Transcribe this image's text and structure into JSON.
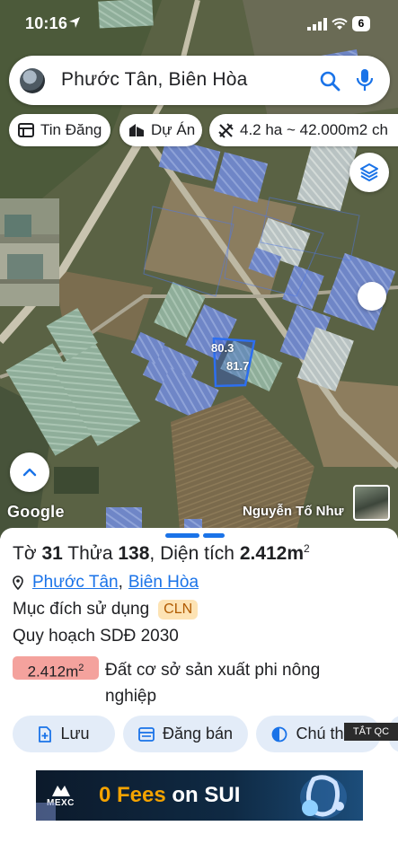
{
  "status_bar": {
    "time": "10:16",
    "battery": "6"
  },
  "search": {
    "query": "Phước Tân, Biên Hòa"
  },
  "chips": [
    {
      "label": "Tin Đăng",
      "icon": "listing-icon"
    },
    {
      "label": "Dự Án",
      "icon": "project-icon"
    },
    {
      "label": "4.2 ha ~ 42.000m2 ch",
      "icon": "measure-icon"
    }
  ],
  "map": {
    "parcel_labels": [
      "80.3",
      "81.7"
    ],
    "provider": "Google",
    "street_view_label": "Nguyễn Tố Như"
  },
  "parcel": {
    "to_label": "Tờ",
    "to_value": "31",
    "thua_label": "Thửa",
    "thua_value": "138",
    "area_label": "Diện tích",
    "area_value": "2.412m",
    "area_unit_sup": "2",
    "ward": "Phước Tân",
    "city": "Biên Hòa",
    "purpose_label": "Mục đích sử dụng",
    "purpose_code": "CLN",
    "plan_label": "Quy hoạch SDĐ 2030",
    "plan_area": "2.412m",
    "plan_area_sup": "2",
    "plan_land_type": "Đất cơ sở sản xuất phi nông nghiệp"
  },
  "actions": [
    {
      "label": "Lưu",
      "icon": "save-icon"
    },
    {
      "label": "Đăng bán",
      "icon": "post-sale-icon"
    },
    {
      "label": "Chú thích",
      "icon": "legend-icon"
    }
  ],
  "ads": {
    "hide_label": "TẮT QC",
    "brand": "MEXC",
    "headline_num": "0 Fees",
    "headline_rest": " on SUI"
  },
  "colors": {
    "accent": "#1a73e8",
    "purpose_badge_bg": "#fde3b4",
    "plan_area_bg": "#f4a29d",
    "action_bg": "#e3ecf8",
    "ad_highlight": "#f4a300"
  }
}
